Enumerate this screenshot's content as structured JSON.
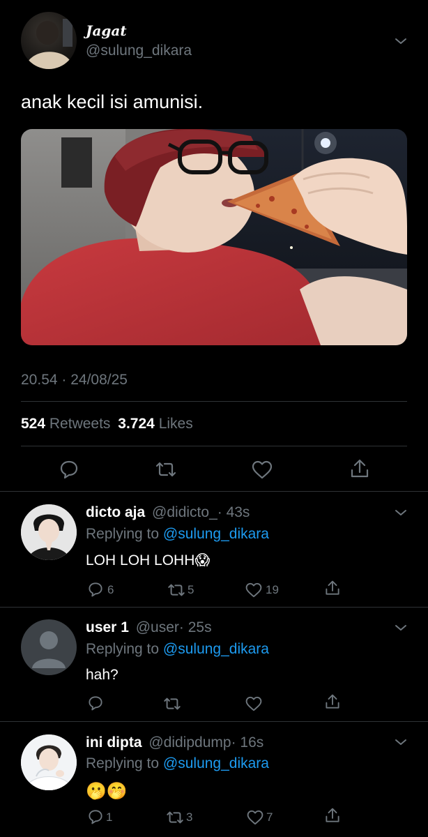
{
  "tweet": {
    "author_name": "Jagat",
    "author_handle": "@sulung_dikara",
    "text": "anak kecil isi amunisi.",
    "timestamp": "20.54 · 24/08/25",
    "retweets_count": "524",
    "retweets_label": "Retweets",
    "likes_count": "3.724",
    "likes_label": "Likes"
  },
  "replies": [
    {
      "name": "dicto aja",
      "handle": "@didicto_",
      "time": "· 43s",
      "replying_prefix": "Replying to",
      "replying_to": "@sulung_dikara",
      "text": "LOH LOH LOHH😱",
      "reply_count": "6",
      "retweet_count": "5",
      "like_count": "19"
    },
    {
      "name": "user 1",
      "handle": "@user",
      "time": "· 25s",
      "replying_prefix": "Replying to",
      "replying_to": "@sulung_dikara",
      "text": "hah?",
      "reply_count": "",
      "retweet_count": "",
      "like_count": ""
    },
    {
      "name": "ini dipta",
      "handle": "@didipdump",
      "time": "· 16s",
      "replying_prefix": "Replying to",
      "replying_to": "@sulung_dikara",
      "text": "🫢🤭",
      "reply_count": "1",
      "retweet_count": "3",
      "like_count": "7"
    }
  ],
  "icons": {
    "reply": "speech-bubble-icon",
    "retweet": "retweet-arrows-icon",
    "like": "heart-icon",
    "share": "share-upload-icon",
    "more": "chevron-down-icon"
  },
  "colors": {
    "background": "#000000",
    "text": "#ffffff",
    "muted": "#6e767d",
    "link": "#1d9bf0",
    "divider": "#2f3336"
  }
}
